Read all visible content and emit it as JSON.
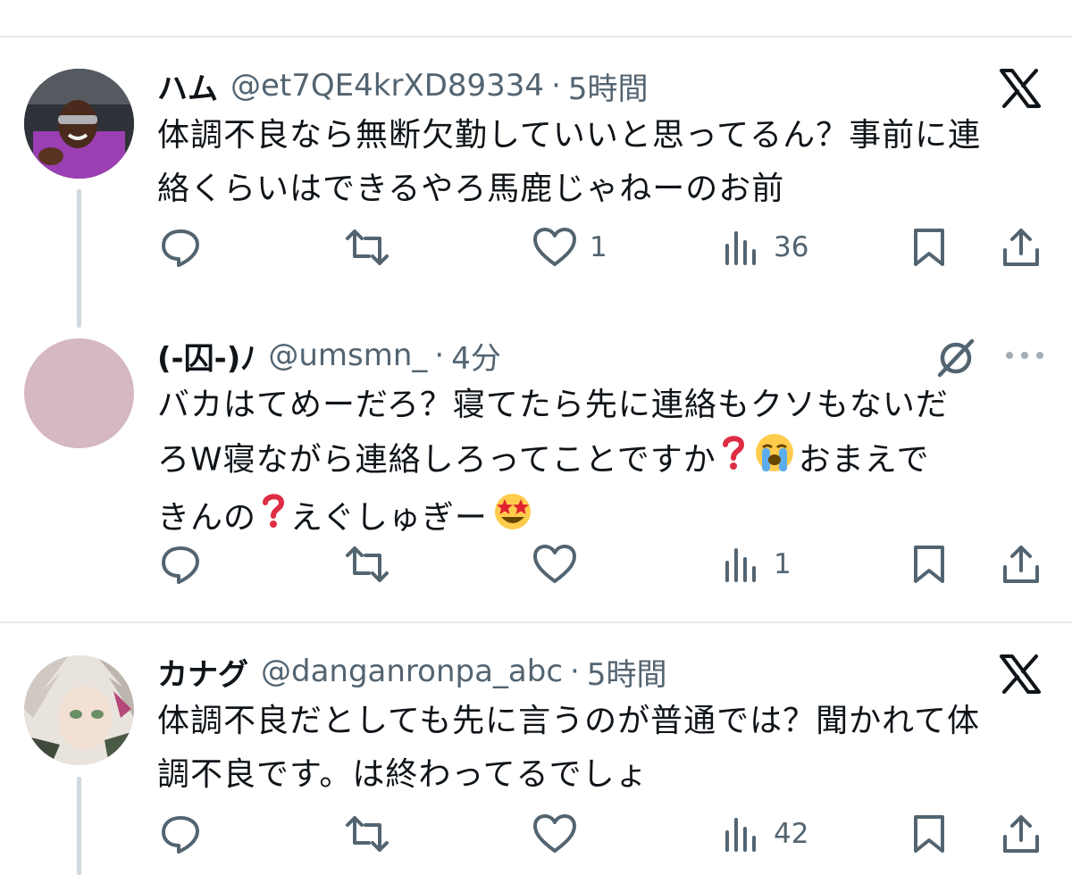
{
  "tweets": [
    {
      "name": "ハム",
      "handle": "@et7QE4krXD89334",
      "separator": "·",
      "time": "5時間",
      "lines": [
        "体調不良なら無断欠勤していいと思ってるん？事前に連",
        "絡くらいはできるやろ馬鹿じゃねーのお前"
      ],
      "counts": {
        "reply": "",
        "retweet": "",
        "like": "1",
        "views": "36"
      },
      "corner_icon": "x-logo-icon"
    },
    {
      "name": "(-囚-)ﾉ",
      "handle": "@umsmn_",
      "separator": "·",
      "time": "4分",
      "line1": "バカはてめーだろ？寝てたら先に連絡もクソもないだ",
      "line2a": "ろW寝ながら連絡しろってことですか",
      "line2b": "おまえで",
      "line3a": "きんの",
      "line3b": "えぐしゅぎー",
      "counts": {
        "reply": "",
        "retweet": "",
        "like": "",
        "views": "1"
      },
      "corner_icon": "grok-icon",
      "more_icon": "more-horizontal-icon"
    },
    {
      "name": "カナグ",
      "handle": "@danganronpa_abc",
      "separator": "·",
      "time": "5時間",
      "lines": [
        "体調不良だとしても先に言うのが普通では？聞かれて体",
        "調不良です。は終わってるでしょ"
      ],
      "counts": {
        "reply": "",
        "retweet": "",
        "like": "",
        "views": "42"
      },
      "corner_icon": "x-logo-icon"
    }
  ],
  "icons": {
    "reply": "reply-icon",
    "retweet": "retweet-icon",
    "like": "heart-icon",
    "views": "views-icon",
    "bookmark": "bookmark-icon",
    "share": "share-icon",
    "emoji_question": "red-question-mark-icon",
    "emoji_crying": "loudly-crying-face-icon",
    "emoji_star_struck": "star-struck-face-icon"
  },
  "colors": {
    "text": "#0f1419",
    "secondary": "#536471",
    "divider": "#e6e9ec",
    "thread_line": "#cfd9de",
    "avatar_placeholder": "#d5b8c1"
  }
}
